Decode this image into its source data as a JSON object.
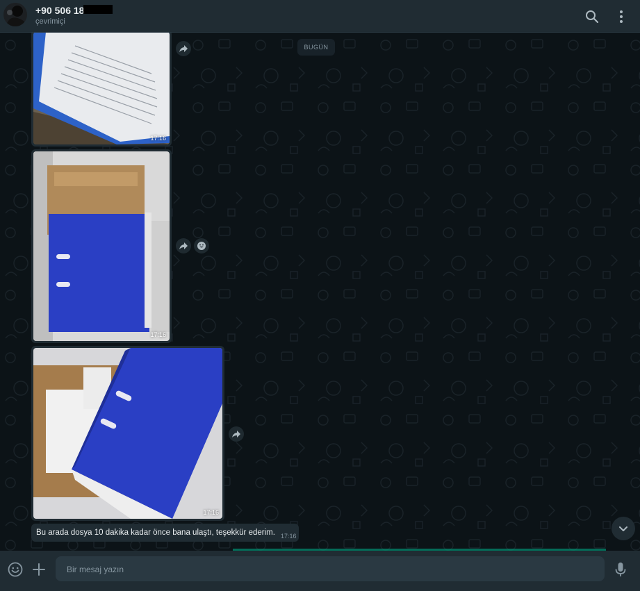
{
  "header": {
    "contact_name": "+90 506 181",
    "contact_status": "çevrimiçi",
    "icons": {
      "search": "search-icon",
      "menu": "more-vertical-icon"
    }
  },
  "chat": {
    "day_label": "BUGÜN",
    "messages": [
      {
        "type": "image",
        "subject": "document-in-folder",
        "time": "17:16"
      },
      {
        "type": "image",
        "subject": "blue-binder-on-cardboard",
        "time": "17:16"
      },
      {
        "type": "image",
        "subject": "blue-binder-on-box",
        "time": "17:16"
      },
      {
        "type": "text",
        "text": "Bu arada dosya 10 dakika kadar önce bana ulaştı, teşekkür ederim.",
        "time": "17:16"
      }
    ]
  },
  "composer": {
    "placeholder": "Bir mesaj yazın",
    "icons": {
      "emoji": "emoji-icon",
      "attach": "plus-icon",
      "voice": "microphone-icon"
    }
  },
  "colors": {
    "header_bg": "#202c33",
    "chat_bg": "#0c1317",
    "bubble_bg": "#202c33",
    "accent": "#00a884",
    "binder_blue": "#2a3fc4"
  }
}
